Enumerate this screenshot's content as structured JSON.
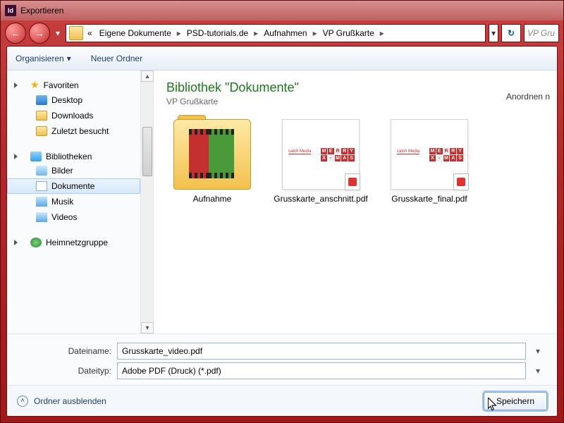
{
  "window": {
    "title": "Exportieren",
    "app_icon_text": "Id"
  },
  "nav": {
    "breadcrumb_prefix": "«",
    "crumbs": [
      "Eigene Dokumente",
      "PSD-tutorials.de",
      "Aufnahmen",
      "VP Grußkarte"
    ],
    "search_placeholder": "VP Gru"
  },
  "toolbar": {
    "organize": "Organisieren",
    "new_folder": "Neuer Ordner"
  },
  "sidebar": {
    "favorites_label": "Favoriten",
    "favorites": [
      "Desktop",
      "Downloads",
      "Zuletzt besucht"
    ],
    "libraries_label": "Bibliotheken",
    "libraries": [
      "Bilder",
      "Dokumente",
      "Musik",
      "Videos"
    ],
    "homegroup_label": "Heimnetzgruppe",
    "selected": "Dokumente"
  },
  "content": {
    "heading": "Bibliothek \"Dokumente\"",
    "subheading": "VP Grußkarte",
    "arrange_label": "Anordnen n",
    "items": [
      {
        "type": "folder",
        "label": "Aufnahme"
      },
      {
        "type": "pdf",
        "label": "Grusskarte_anschnitt.pdf"
      },
      {
        "type": "pdf",
        "label": "Grusskarte_final.pdf"
      }
    ],
    "xmas_top": "MERRY",
    "xmas_bottom": "X-MAS",
    "catch": "catch Media"
  },
  "form": {
    "filename_label": "Dateiname:",
    "filename_value": "Grusskarte_video.pdf",
    "filetype_label": "Dateityp:",
    "filetype_value": "Adobe PDF (Druck) (*.pdf)"
  },
  "footer": {
    "hide_folders": "Ordner ausblenden",
    "save": "Speichern"
  }
}
